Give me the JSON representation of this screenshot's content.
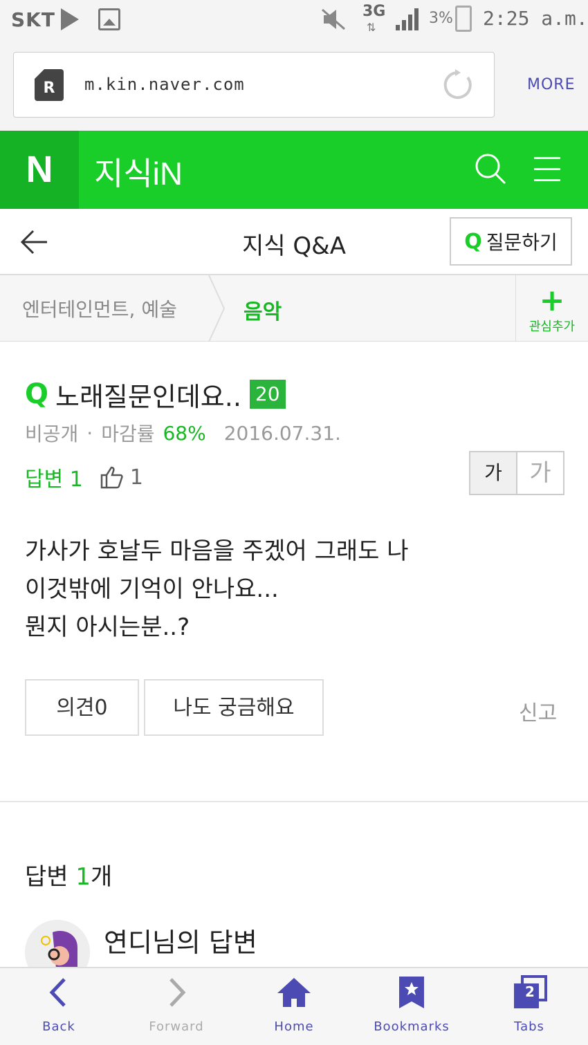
{
  "status_bar": {
    "carrier": "SKT",
    "network": "3G",
    "battery": "3%",
    "time": "2:25 a.m."
  },
  "browser": {
    "url": "m.kin.naver.com",
    "more_label": "MORE"
  },
  "header": {
    "logo": "N",
    "title": "지식iN"
  },
  "subheader": {
    "title": "지식 Q&A",
    "ask_label": "질문하기"
  },
  "category": {
    "parent": "엔터테인먼트, 예술",
    "current": "음악",
    "favorite_label": "관심추가"
  },
  "question": {
    "mark": "Q",
    "title": "노래질문인데요..",
    "points": "20",
    "visibility": "비공개",
    "close_rate_label": "마감률",
    "close_rate": "68%",
    "date": "2016.07.31.",
    "answers_label": "답변 1",
    "likes": "1",
    "font_small": "가",
    "font_large": "가",
    "body": "가사가 호날두 마음을 주겠어 그래도 나\n이것밖에 기억이 안나요...\n뭔지 아시는분..?"
  },
  "actions": {
    "opinion_label": "의견0",
    "curious_label": "나도 궁금해요",
    "report_label": "신고"
  },
  "answers": {
    "heading_prefix": "답변 ",
    "count": "1",
    "heading_suffix": "개",
    "first_answerer": "연디님의 답변"
  },
  "toolbar": {
    "back": "Back",
    "forward": "Forward",
    "home": "Home",
    "bookmarks": "Bookmarks",
    "tabs": "Tabs",
    "tab_count": "2"
  },
  "colors": {
    "naver_green": "#19ce28",
    "toolbar_accent": "#4b4bb3"
  }
}
